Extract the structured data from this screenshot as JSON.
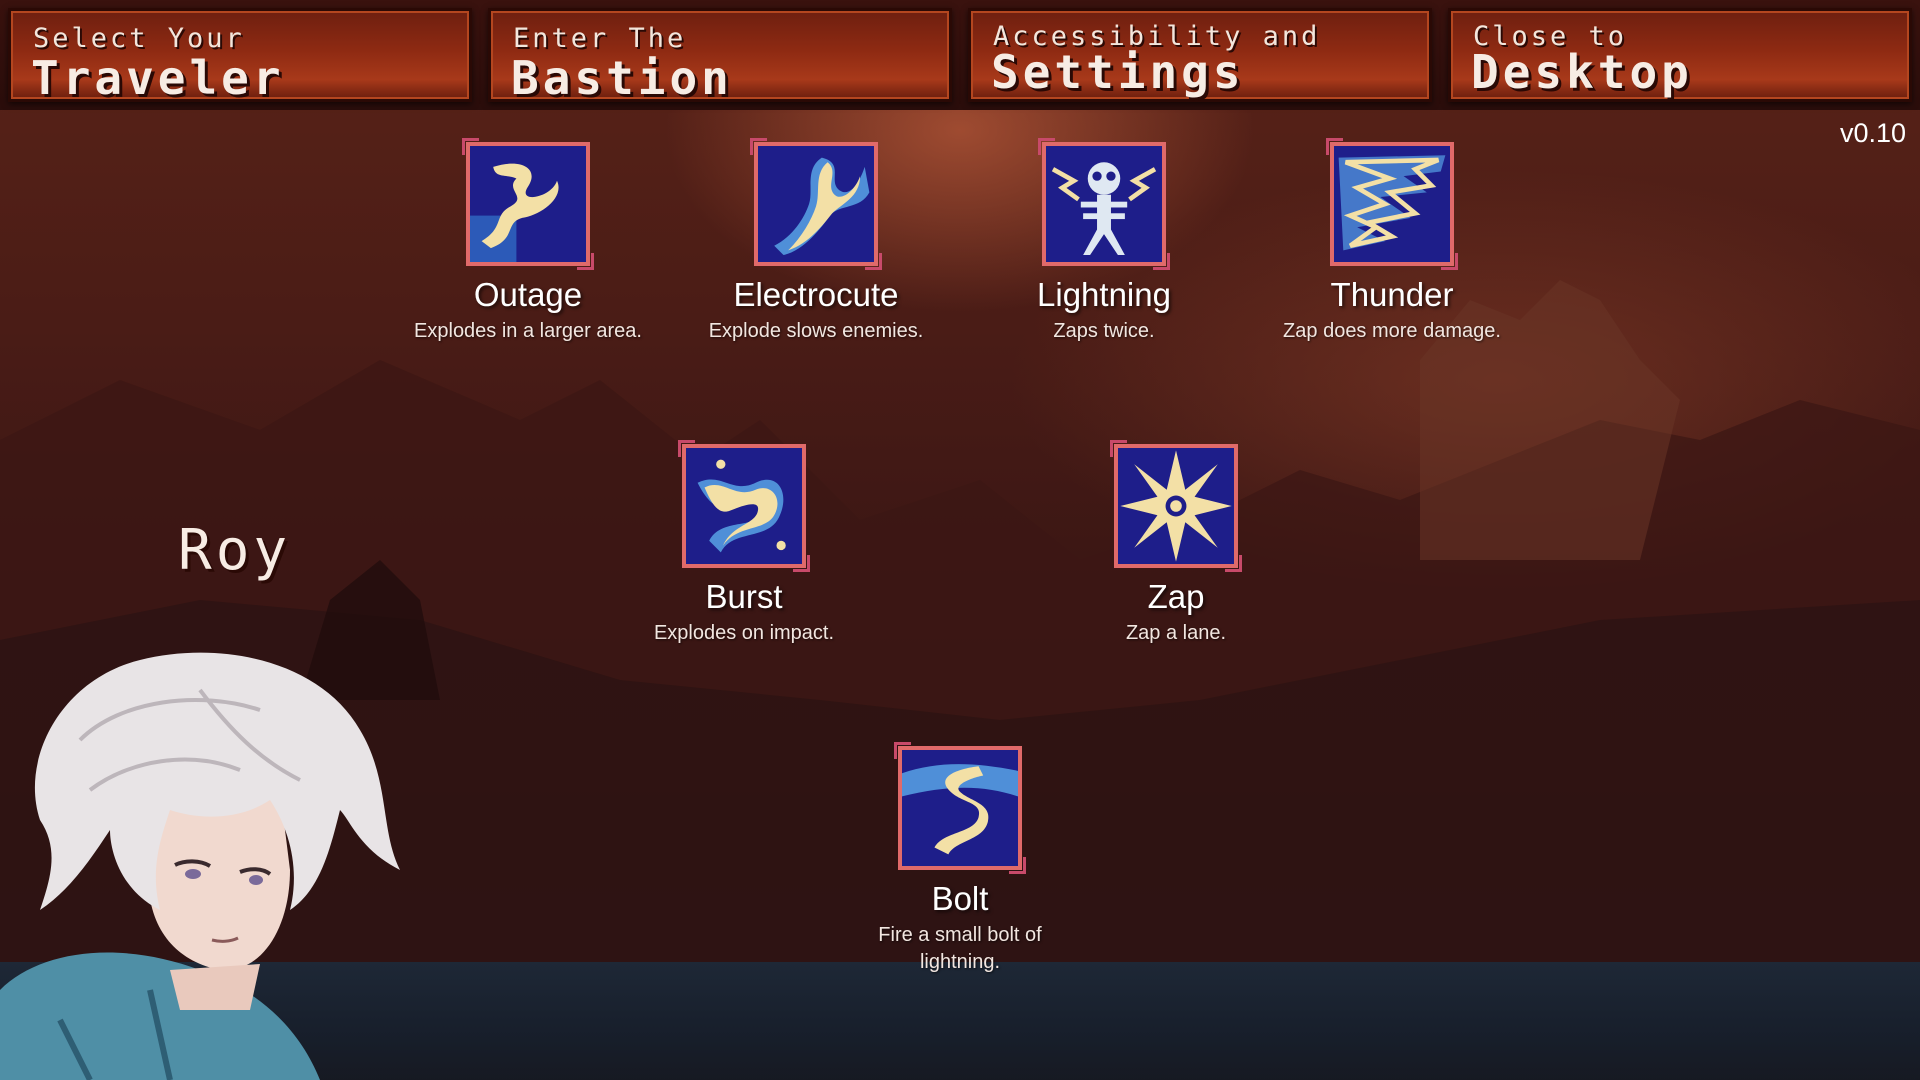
{
  "menu": [
    {
      "small": "Select Your",
      "big": "Traveler"
    },
    {
      "small": "Enter The",
      "big": "Bastion"
    },
    {
      "small": "Accessibility and",
      "big": "Settings"
    },
    {
      "small": "Close to",
      "big": "Desktop"
    }
  ],
  "version": "v0.10",
  "character": {
    "name": "Roy"
  },
  "skills": {
    "outage": {
      "name": "Outage",
      "desc": "Explodes in a larger area.",
      "icon": "lightning-bolt-icon"
    },
    "electrocute": {
      "name": "Electrocute",
      "desc": "Explode slows enemies.",
      "icon": "electric-hand-icon"
    },
    "lightning": {
      "name": "Lightning",
      "desc": "Zaps twice.",
      "icon": "skeleton-shock-icon"
    },
    "thunder": {
      "name": "Thunder",
      "desc": "Zap does more damage.",
      "icon": "storm-icon"
    },
    "burst": {
      "name": "Burst",
      "desc": "Explodes on impact.",
      "icon": "burst-icon"
    },
    "zap": {
      "name": "Zap",
      "desc": "Zap a lane.",
      "icon": "sun-star-icon"
    },
    "bolt": {
      "name": "Bolt",
      "desc": "Fire a small bolt of lightning.",
      "icon": "bolt-icon"
    }
  },
  "colors": {
    "button_fill": "#8e2a12",
    "icon_border": "#e06a6a",
    "icon_bg": "#1b1b7a",
    "icon_glow": "#f3e0a6"
  }
}
